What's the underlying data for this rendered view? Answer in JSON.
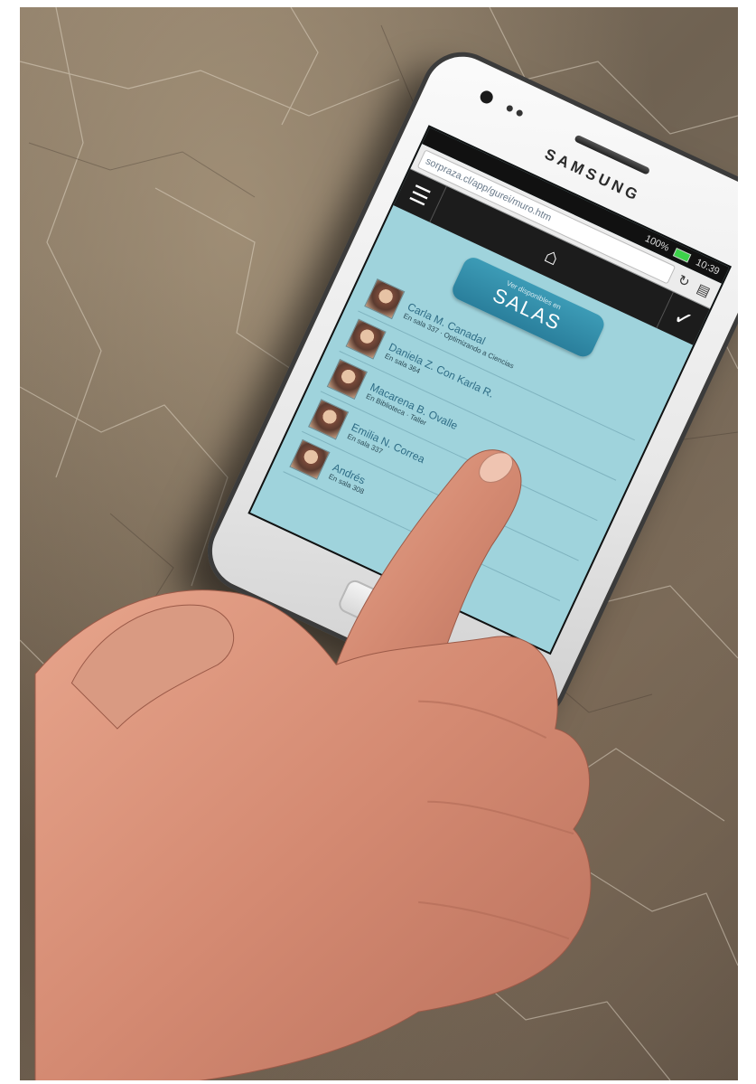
{
  "phone": {
    "brand": "SAMSUNG",
    "status_time": "10:39",
    "status_battery": "100%",
    "url": "sorpraza.cl/app/gurei/muro.htm"
  },
  "app": {
    "salas_subtitle": "Ver disponibles en",
    "salas_title": "SALAS",
    "people": [
      {
        "name": "Carla M. Canadal",
        "detail": "En sala 337 · Optimizando a Ciencias"
      },
      {
        "name": "Daniela Z. Con Karla R.",
        "detail": "En sala 364"
      },
      {
        "name": "Macarena B. Ovalle",
        "detail": "En Biblioteca · Taller"
      },
      {
        "name": "Emilia N. Correa",
        "detail": "En sala 337"
      },
      {
        "name": "Andrés",
        "detail": "En sala 308"
      }
    ]
  },
  "colors": {
    "screen_bg": "#9fd3dc",
    "accent": "#2a7f9c",
    "navbar": "#1c1c1c"
  },
  "icons": [
    "menu-icon",
    "home-icon",
    "check-icon",
    "refresh-icon",
    "bookmark-icon"
  ]
}
